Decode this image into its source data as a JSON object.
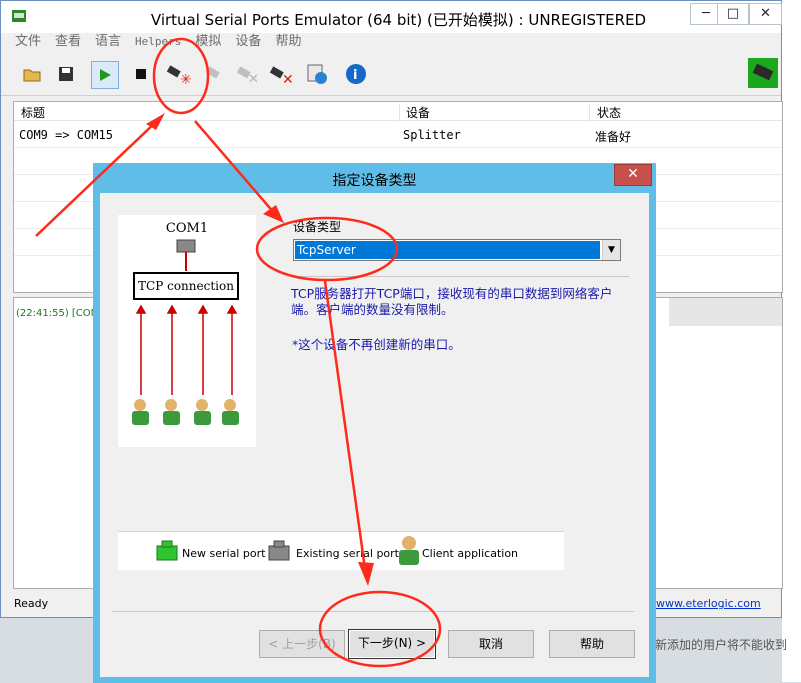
{
  "main_window": {
    "title": "Virtual Serial Ports Emulator (64 bit) (已开始模拟) : UNREGISTERED",
    "controls": {
      "minimize": "─",
      "maximize": "□",
      "close": "✕"
    }
  },
  "menu": [
    "文件",
    "查看",
    "语言",
    "Helpers",
    "模拟",
    "设备",
    "帮助"
  ],
  "toolbar": {
    "icons": [
      "open-icon",
      "save-icon",
      "start-icon",
      "stop-icon",
      "new-device-icon",
      "edit-device-icon",
      "disabled-device-icon",
      "delete-device-icon",
      "settings-icon",
      "info-icon",
      "logo-icon"
    ]
  },
  "device_list": {
    "columns": [
      "标题",
      "设备",
      "状态"
    ],
    "rows": [
      {
        "title": "COM9 => COM15",
        "device": "Splitter",
        "status": "准备好"
      }
    ]
  },
  "log": {
    "line": "(22:41:55) [COM"
  },
  "status_bar": {
    "text": "Ready",
    "link": "www.eterlogic.com"
  },
  "background_fragments": {
    "bottom_right": "新添加的用户将不能收到"
  },
  "dialog": {
    "title": "指定设备类型",
    "close": "✕",
    "illustration": {
      "port_label": "COM1",
      "connection_label": "TCP connection"
    },
    "device_type_label": "设备类型",
    "device_type_value": "TcpServer",
    "description": "TCP服务器打开TCP端口，接收现有的串口数据到网络客户端。客户端的数量没有限制。",
    "note": "*这个设备不再创建新的串口。",
    "legend": {
      "new_port": "New serial port",
      "existing_port": "Existing serial port",
      "client_app": "Client application"
    },
    "buttons": {
      "back": "< 上一步(B)",
      "next": "下一步(N) >",
      "cancel": "取消",
      "help": "帮助"
    }
  },
  "colors": {
    "accent": "#0078d7",
    "annotation": "#ff2a1a",
    "dialog_frame": "#5fbde7"
  }
}
